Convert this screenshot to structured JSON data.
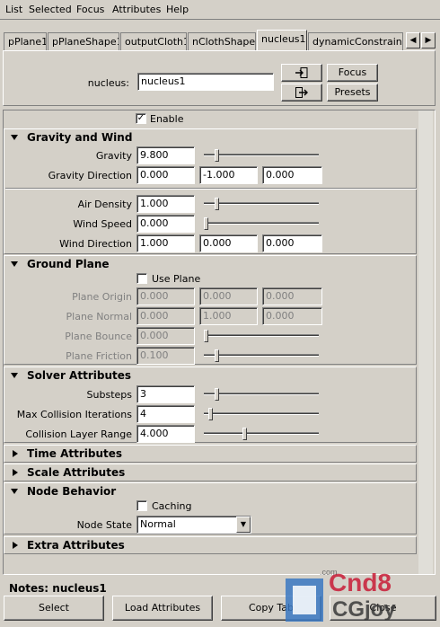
{
  "menubar": [
    "List",
    "Selected",
    "Focus",
    "Attributes",
    "Help"
  ],
  "tabs": [
    "pPlane1",
    "pPlaneShape1",
    "outputCloth1",
    "nClothShape1",
    "nucleus1",
    "dynamicConstraintSha"
  ],
  "header": {
    "label": "nucleus:",
    "value": "nucleus1",
    "focus_label": "Focus",
    "presets_label": "Presets"
  },
  "enable_label": "Enable",
  "gravity_wind": {
    "title": "Gravity and Wind",
    "gravity_label": "Gravity",
    "gravity_value": "9.800",
    "gravity_slider": 0.1,
    "gravity_dir_label": "Gravity Direction",
    "gravity_dir": [
      "0.000",
      "-1.000",
      "0.000"
    ],
    "air_density_label": "Air Density",
    "air_density_value": "1.000",
    "air_density_slider": 0.1,
    "wind_speed_label": "Wind Speed",
    "wind_speed_value": "0.000",
    "wind_speed_slider": 0.0,
    "wind_dir_label": "Wind Direction",
    "wind_dir": [
      "1.000",
      "0.000",
      "0.000"
    ]
  },
  "ground_plane": {
    "title": "Ground Plane",
    "use_plane_label": "Use Plane",
    "origin_label": "Plane Origin",
    "origin": [
      "0.000",
      "0.000",
      "0.000"
    ],
    "normal_label": "Plane Normal",
    "normal": [
      "0.000",
      "1.000",
      "0.000"
    ],
    "bounce_label": "Plane Bounce",
    "bounce_value": "0.000",
    "bounce_slider": 0.0,
    "friction_label": "Plane Friction",
    "friction_value": "0.100",
    "friction_slider": 0.1
  },
  "solver": {
    "title": "Solver Attributes",
    "substeps_label": "Substeps",
    "substeps_value": "3",
    "substeps_slider": 0.1,
    "max_collision_label": "Max Collision Iterations",
    "max_collision_value": "4",
    "max_collision_slider": 0.04,
    "collision_layer_label": "Collision Layer Range",
    "collision_layer_value": "4.000",
    "collision_layer_slider": 0.35
  },
  "collapsed_sections": [
    "Time Attributes",
    "Scale Attributes"
  ],
  "node_behavior": {
    "title": "Node Behavior",
    "caching_label": "Caching",
    "node_state_label": "Node State",
    "node_state_value": "Normal"
  },
  "extra_attributes_title": "Extra Attributes",
  "notes_label": "Notes:  nucleus1",
  "bottom_buttons": [
    "Select",
    "Load Attributes",
    "Copy Tab",
    "Close"
  ],
  "watermark": [
    "Cnd8",
    "CGjoy",
    ".com"
  ]
}
